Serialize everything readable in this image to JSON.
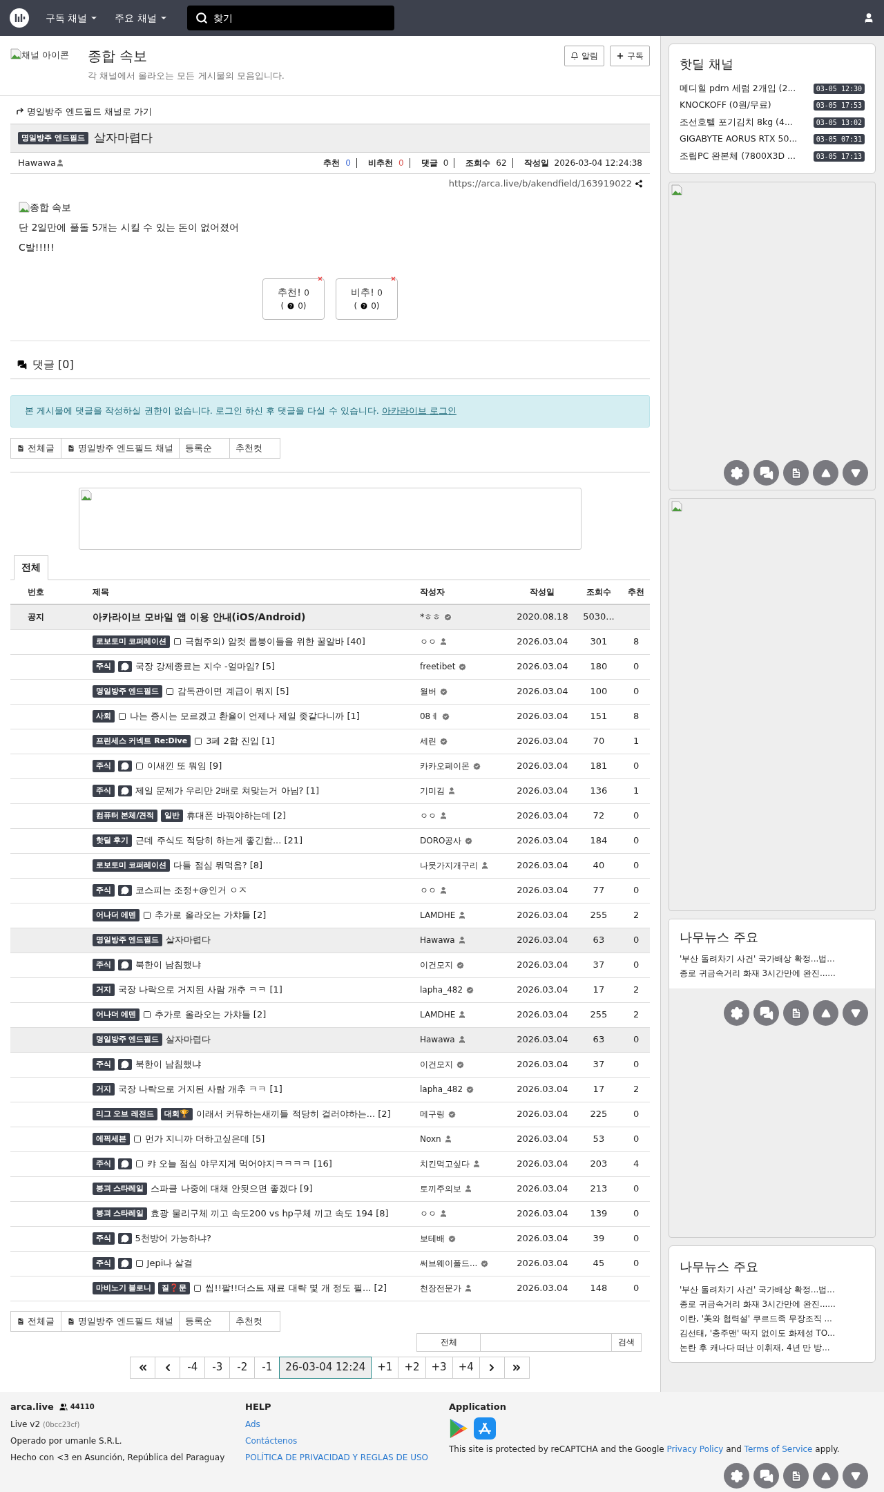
{
  "nav": {
    "menus": [
      "구독 채널",
      "주요 채널"
    ],
    "search": {
      "placeholder": "찾기"
    }
  },
  "channel": {
    "icon_alt": "채널 아이콘",
    "title": "종합 속보",
    "description": "각 채널에서 올라오는 모든 게시물의 모음입니다.",
    "buttons": [
      {
        "kind": "bell",
        "label": "알림"
      },
      {
        "kind": "plus",
        "label": "구독"
      }
    ]
  },
  "post": {
    "back_link": "명일방주 엔드필드 채널로 가기",
    "category": "명일방주 엔드필드",
    "title": "살자마렵다",
    "author": "Hawawa",
    "stats": [
      {
        "label": "추천",
        "value": "0",
        "color": "#3d6ad6"
      },
      {
        "label": "비추천",
        "value": "0",
        "color": "#d9534f"
      },
      {
        "label": "댓글",
        "value": "0"
      },
      {
        "label": "조회수",
        "value": "62"
      },
      {
        "label": "작성일",
        "value": "2026-03-04 12:24:38"
      }
    ],
    "url": "https://arca.live/b/akendfield/163919022",
    "image_alt": "종합 속보",
    "lines": [
      "단 2일만에 풀돌 5개는 시킬 수 있는 돈이 없어졌어",
      "C발!!!!!"
    ],
    "votes": [
      {
        "label": "추천!",
        "count": "0",
        "sub_open": "(",
        "sub": "0)"
      },
      {
        "label": "비추!",
        "count": "0",
        "sub_open": "(",
        "sub": "0)"
      }
    ]
  },
  "comments": {
    "title": "댓글 [0]",
    "notice": "본 게시물에 댓글을 작성하실 권한이 없습니다. 로그인 하신 후 댓글을 다실 수 있습니다.",
    "login_link": "아카라이브 로그인"
  },
  "list_tabs_top": [
    {
      "kind": "icon",
      "label": "전체글"
    },
    {
      "kind": "icon",
      "label": "명일방주 엔드필드 채널"
    },
    {
      "kind": "plain",
      "label": "등록순"
    },
    {
      "kind": "plain",
      "label": "추천컷"
    }
  ],
  "board": {
    "tab": "전체",
    "columns": [
      "번호",
      "제목",
      "작성자",
      "작성일",
      "조회수",
      "추천"
    ],
    "notice": {
      "number": "공지",
      "title": "아카라이브 모바일 앱 이용 안내(iOS/Android)",
      "author": {
        "name": "*ㅎㅎ",
        "kind": "verified"
      },
      "date": "2020.08.18",
      "views": "5030..."
    },
    "rows": [
      {
        "badges": [
          "로보토미 코퍼레이션"
        ],
        "comment_icon": false,
        "image_icon": true,
        "title": "극혐주의) 암컷 롭붕이들을 위한 꿀알바 [40]",
        "author": {
          "name": "ㅇㅇ",
          "kind": "user"
        },
        "date": "2026.03.04",
        "views": "301",
        "likes": "8",
        "current": false
      },
      {
        "badges": [
          "주식"
        ],
        "comment_icon": true,
        "image_icon": false,
        "title": "국장 강제종료는 지수 -얼마임? [5]",
        "author": {
          "name": "freetibet",
          "kind": "verified"
        },
        "date": "2026.03.04",
        "views": "180",
        "likes": "0",
        "current": false
      },
      {
        "badges": [
          "명일방주 엔드필드"
        ],
        "comment_icon": false,
        "image_icon": true,
        "title": "감독관이면 계급이 뭐지 [5]",
        "author": {
          "name": "월버",
          "kind": "verified"
        },
        "date": "2026.03.04",
        "views": "100",
        "likes": "0",
        "current": false
      },
      {
        "badges": [
          "사회"
        ],
        "comment_icon": false,
        "image_icon": true,
        "title": "나는 증시는 모르겠고 환율이 언제나 제일 좆같다니까 [1]",
        "author": {
          "name": "08ㅔ",
          "kind": "verified"
        },
        "date": "2026.03.04",
        "views": "151",
        "likes": "8",
        "current": false
      },
      {
        "badges": [
          "프린세스 커넥트 Re:Dive"
        ],
        "comment_icon": false,
        "image_icon": true,
        "title": "3페 2합 진입 [1]",
        "author": {
          "name": "세린",
          "kind": "verified"
        },
        "date": "2026.03.04",
        "views": "70",
        "likes": "1",
        "current": false
      },
      {
        "badges": [
          "주식"
        ],
        "comment_icon": true,
        "image_icon": true,
        "title": "이새낀 또 뭐임 [9]",
        "author": {
          "name": "카카오페이몬",
          "kind": "verified"
        },
        "date": "2026.03.04",
        "views": "181",
        "likes": "0",
        "current": false
      },
      {
        "badges": [
          "주식"
        ],
        "comment_icon": true,
        "image_icon": false,
        "title": "제일 문제가 우리만 2배로 쳐맞는거 아님? [1]",
        "author": {
          "name": "기미김",
          "kind": "user"
        },
        "date": "2026.03.04",
        "views": "136",
        "likes": "1",
        "current": false
      },
      {
        "badges": [
          "컴퓨터 본체/견적",
          "일반"
        ],
        "comment_icon": false,
        "image_icon": false,
        "title": "휴대폰 바꿔야하는데 [2]",
        "author": {
          "name": "ㅇㅇ",
          "kind": "user"
        },
        "date": "2026.03.04",
        "views": "72",
        "likes": "0",
        "current": false
      },
      {
        "badges": [
          "핫딜 후기"
        ],
        "comment_icon": false,
        "image_icon": false,
        "title": "근데 주식도 적당히 하는게 좋긴함... [21]",
        "author": {
          "name": "DORO공사",
          "kind": "verified"
        },
        "date": "2026.03.04",
        "views": "184",
        "likes": "0",
        "current": false
      },
      {
        "badges": [
          "로보토미 코퍼레이션"
        ],
        "comment_icon": false,
        "image_icon": false,
        "title": "다들 점심 뭐먹음? [8]",
        "author": {
          "name": "나뭇가지개구리",
          "kind": "user"
        },
        "date": "2026.03.04",
        "views": "40",
        "likes": "0",
        "current": false
      },
      {
        "badges": [
          "주식"
        ],
        "comment_icon": true,
        "image_icon": false,
        "title": "코스피는 조정+@인거 ㅇㅈ",
        "author": {
          "name": "ㅇㅇ",
          "kind": "user"
        },
        "date": "2026.03.04",
        "views": "77",
        "likes": "0",
        "current": false
      },
      {
        "badges": [
          "어나더 에덴"
        ],
        "comment_icon": false,
        "image_icon": true,
        "title": "추가로 올라오는 가챠들 [2]",
        "author": {
          "name": "LAMDHE",
          "kind": "user"
        },
        "date": "2026.03.04",
        "views": "255",
        "likes": "2",
        "current": false
      },
      {
        "badges": [
          "명일방주 엔드필드"
        ],
        "comment_icon": false,
        "image_icon": false,
        "title": "살자마렵다",
        "author": {
          "name": "Hawawa",
          "kind": "user"
        },
        "date": "2026.03.04",
        "views": "63",
        "likes": "0",
        "current": true
      },
      {
        "badges": [
          "주식"
        ],
        "comment_icon": true,
        "image_icon": false,
        "title": "북한이 남침했냐",
        "author": {
          "name": "이건모지",
          "kind": "verified"
        },
        "date": "2026.03.04",
        "views": "37",
        "likes": "0",
        "current": false
      },
      {
        "badges": [
          "거지"
        ],
        "comment_icon": false,
        "image_icon": false,
        "title": "국장 나락으로 거지된 사람 개추 ㅋㅋ [1]",
        "author": {
          "name": "lapha_482",
          "kind": "verified"
        },
        "date": "2026.03.04",
        "views": "17",
        "likes": "2",
        "current": false
      },
      {
        "badges": [
          "어나더 에덴"
        ],
        "comment_icon": false,
        "image_icon": true,
        "title": "추가로 올라오는 가챠들 [2]",
        "author": {
          "name": "LAMDHE",
          "kind": "user"
        },
        "date": "2026.03.04",
        "views": "255",
        "likes": "2",
        "current": false
      },
      {
        "badges": [
          "명일방주 엔드필드"
        ],
        "comment_icon": false,
        "image_icon": false,
        "title": "살자마렵다",
        "author": {
          "name": "Hawawa",
          "kind": "user"
        },
        "date": "2026.03.04",
        "views": "63",
        "likes": "0",
        "current": true
      },
      {
        "badges": [
          "주식"
        ],
        "comment_icon": true,
        "image_icon": false,
        "title": "북한이 남침했냐",
        "author": {
          "name": "이건모지",
          "kind": "verified"
        },
        "date": "2026.03.04",
        "views": "37",
        "likes": "0",
        "current": false
      },
      {
        "badges": [
          "거지"
        ],
        "comment_icon": false,
        "image_icon": false,
        "title": "국장 나락으로 거지된 사람 개추 ㅋㅋ [1]",
        "author": {
          "name": "lapha_482",
          "kind": "verified"
        },
        "date": "2026.03.04",
        "views": "17",
        "likes": "2",
        "current": false
      },
      {
        "badges": [
          "리그 오브 레전드",
          "대회🏆"
        ],
        "comment_icon": false,
        "image_icon": false,
        "title": "이래서 커뮤하는새끼들 적당히 걸러야하는... [2]",
        "author": {
          "name": "메구링",
          "kind": "verified"
        },
        "date": "2026.03.04",
        "views": "225",
        "likes": "0",
        "current": false
      },
      {
        "badges": [
          "에픽세븐"
        ],
        "comment_icon": false,
        "image_icon": true,
        "title": "먼가 지니까 더하고싶은데 [5]",
        "author": {
          "name": "Noxn",
          "kind": "user"
        },
        "date": "2026.03.04",
        "views": "53",
        "likes": "0",
        "current": false
      },
      {
        "badges": [
          "주식"
        ],
        "comment_icon": true,
        "image_icon": true,
        "title": "캬 오늘 점심 야무지게 먹어야지ㅋㅋㅋㅋ [16]",
        "author": {
          "name": "치킨먹고싶다",
          "kind": "user"
        },
        "date": "2026.03.04",
        "views": "203",
        "likes": "4",
        "current": false
      },
      {
        "badges": [
          "붕괴 스타레일"
        ],
        "comment_icon": false,
        "image_icon": false,
        "title": "스파클 나중에 대채 안됫으면 좋겠다 [9]",
        "author": {
          "name": "토끼주의보",
          "kind": "user"
        },
        "date": "2026.03.04",
        "views": "213",
        "likes": "0",
        "current": false
      },
      {
        "badges": [
          "붕괴 스타레일"
        ],
        "comment_icon": false,
        "image_icon": false,
        "title": "효광 물리구체 끼고 속도200 vs hp구체 끼고 속도 194 [8]",
        "author": {
          "name": "ㅇㅇ",
          "kind": "user"
        },
        "date": "2026.03.04",
        "views": "139",
        "likes": "0",
        "current": false
      },
      {
        "badges": [
          "주식"
        ],
        "comment_icon": true,
        "image_icon": false,
        "title": "5천방어 가능하냐?",
        "author": {
          "name": "보테배",
          "kind": "verified"
        },
        "date": "2026.03.04",
        "views": "39",
        "likes": "0",
        "current": false
      },
      {
        "badges": [
          "주식"
        ],
        "comment_icon": true,
        "image_icon": true,
        "title": "Jepi나 살걸",
        "author": {
          "name": "써브웨이폴드...",
          "kind": "verified"
        },
        "date": "2026.03.04",
        "views": "45",
        "likes": "0",
        "current": false
      },
      {
        "badges": [
          "마비노기 블로니",
          "질❓문"
        ],
        "comment_icon": false,
        "image_icon": true,
        "title": "씹!!팔!!더스트 재료 대략 몇 개 정도 필... [2]",
        "author": {
          "name": "천장전문가",
          "kind": "user"
        },
        "date": "2026.03.04",
        "views": "148",
        "likes": "0",
        "current": false
      }
    ]
  },
  "list_tabs_bottom": [
    {
      "kind": "icon",
      "label": "전체글"
    },
    {
      "kind": "icon",
      "label": "명일방주 엔드필드 채널"
    },
    {
      "kind": "plain",
      "label": "등록순"
    },
    {
      "kind": "plain",
      "label": "추천컷"
    }
  ],
  "search": {
    "scope": "전체",
    "button": "검색"
  },
  "pagination": [
    {
      "kind": "first"
    },
    {
      "kind": "prev"
    },
    {
      "kind": "page",
      "label": "-4",
      "selected": false
    },
    {
      "kind": "page",
      "label": "-3",
      "selected": false
    },
    {
      "kind": "page",
      "label": "-2",
      "selected": false
    },
    {
      "kind": "page",
      "label": "-1",
      "selected": false
    },
    {
      "kind": "page",
      "label": "26-03-04 12:24",
      "selected": true
    },
    {
      "kind": "page",
      "label": "+1",
      "selected": false
    },
    {
      "kind": "page",
      "label": "+2",
      "selected": false
    },
    {
      "kind": "page",
      "label": "+3",
      "selected": false
    },
    {
      "kind": "page",
      "label": "+4",
      "selected": false
    },
    {
      "kind": "next"
    },
    {
      "kind": "last"
    }
  ],
  "sidebar": {
    "hotdeal": {
      "title": "핫딜 채널",
      "items": [
        {
          "title": "메디힐 pdrn 세럼 2개입 (2...",
          "time": "03-05 12:30"
        },
        {
          "title": "KNOCKOFF (0원/무료)",
          "time": "03-05 17:53"
        },
        {
          "title": "조선호텔 포기김치 8kg (4...",
          "time": "03-05 13:02"
        },
        {
          "title": "GIGABYTE AORUS RTX 50...",
          "time": "03-05 07:31"
        },
        {
          "title": "조립PC 완본체 (7800X3D ...",
          "time": "03-05 17:13"
        }
      ]
    },
    "news_partial": {
      "title": "나무뉴스 주요",
      "items": [
        "'부산 돌려차기 사건' 국가배상 확정...법...",
        "종로 귀금속거리 화재 3시간만에 완진......"
      ]
    },
    "news": {
      "title": "나무뉴스 주요",
      "items": [
        "'부산 돌려차기 사건' 국가배상 확정...법...",
        "종로 귀금속거리 화재 3시간만에 완진......",
        "이란, '美와 협력설' 쿠르드족 무장조직 ...",
        "김선태, '충주맨' 딱지 없이도 화제성 TO...",
        "논란 후 캐나다 떠난 이휘재, 4년 만 방..."
      ]
    }
  },
  "footer": {
    "brand": "arca.live",
    "users": "44110",
    "version": "Live v2",
    "hash": "(0bcc23cf)",
    "operator": "Operado por umanle S.R.L.",
    "made": "Hecho con <3 en Asunción, República del Paraguay",
    "help_title": "HELP",
    "help_links": [
      "Ads",
      "Contáctenos",
      "POLÍTICA DE PRIVACIDAD Y REGLAS DE USO"
    ],
    "app_title": "Application",
    "recaptcha": {
      "before": "This site is protected by reCAPTCHA and the Google",
      "privacy": "Privacy Policy",
      "middle": "and",
      "terms": "Terms of Service",
      "after": "apply."
    }
  }
}
